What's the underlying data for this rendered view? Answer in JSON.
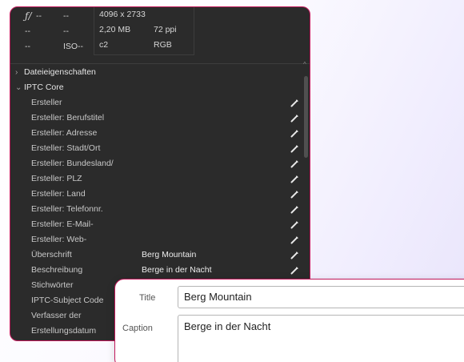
{
  "exif": {
    "fstop": "ƒ/",
    "fstop_val": "--",
    "row2_a": "--",
    "row2_b": "--",
    "row3_a": "--",
    "iso_label": "ISO",
    "iso_val": "--",
    "dimensions": "4096 x 2733",
    "filesize": "2,20 MB",
    "ppi": "72 ppi",
    "profile": "c2",
    "colormode": "RGB"
  },
  "sections": {
    "file_props": "Dateieigenschaften",
    "iptc_core": "IPTC Core"
  },
  "fields": [
    {
      "label": "Ersteller",
      "value": "",
      "edit": true
    },
    {
      "label": "Ersteller: Berufstitel",
      "value": "",
      "edit": true
    },
    {
      "label": "Ersteller: Adresse",
      "value": "",
      "edit": true
    },
    {
      "label": "Ersteller: Stadt/Ort",
      "value": "",
      "edit": true
    },
    {
      "label": "Ersteller: Bundesland/",
      "value": "",
      "edit": true
    },
    {
      "label": "Ersteller: PLZ",
      "value": "",
      "edit": true
    },
    {
      "label": "Ersteller: Land",
      "value": "",
      "edit": true
    },
    {
      "label": "Ersteller: Telefonnr.",
      "value": "",
      "edit": true
    },
    {
      "label": "Ersteller: E-Mail-",
      "value": "",
      "edit": true
    },
    {
      "label": "Ersteller: Web-",
      "value": "",
      "edit": true
    },
    {
      "label": "Überschrift",
      "value": "Berg Mountain",
      "edit": true
    },
    {
      "label": "Beschreibung",
      "value": "Berge in der Nacht",
      "edit": true
    },
    {
      "label": "Stichwörter",
      "value": "",
      "edit": false
    },
    {
      "label": "IPTC-Subject Code",
      "value": "",
      "edit": false
    },
    {
      "label": "Verfasser der",
      "value": "",
      "edit": false
    },
    {
      "label": "Erstellungsdatum",
      "value": "",
      "edit": false
    }
  ],
  "popup": {
    "title_label": "Title",
    "title_value": "Berg Mountain",
    "caption_label": "Caption",
    "caption_value": "Berge in der Nacht"
  },
  "colors": {
    "panel_bg": "#2b2b2b",
    "accent_border": "#c2185b"
  },
  "icons": {
    "edit": "pencil-icon",
    "collapsed": "chevron-right-icon",
    "expanded": "chevron-down-icon"
  }
}
